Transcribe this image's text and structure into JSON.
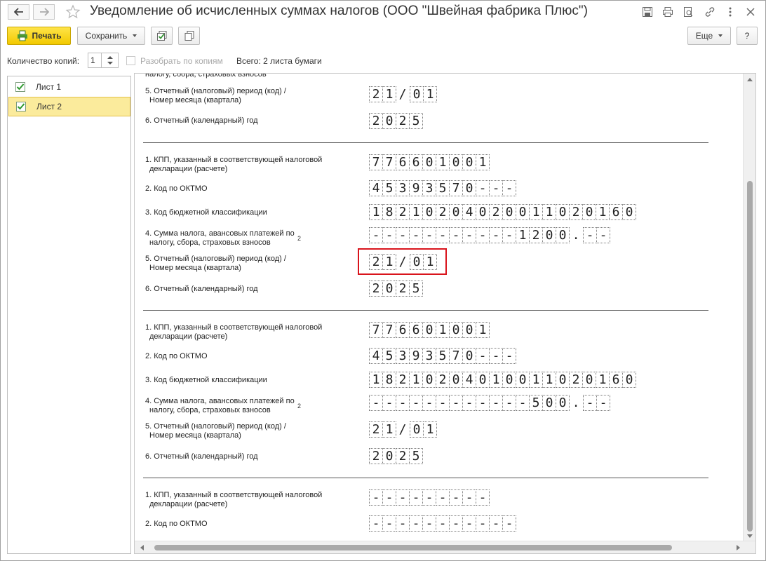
{
  "window": {
    "title": "Уведомление об исчисленных суммах налогов (ООО \"Швейная фабрика Плюс\")"
  },
  "toolbar": {
    "print_label": "Печать",
    "save_label": "Сохранить",
    "more_label": "Еще",
    "help_label": "?"
  },
  "copies": {
    "label": "Количество копий:",
    "value": "1",
    "collate_label": "Разобрать по копиям",
    "total_label": "Всего: 2 листа бумаги"
  },
  "sheets": [
    {
      "label": "Лист 1",
      "checked": true,
      "active": false
    },
    {
      "label": "Лист 2",
      "checked": true,
      "active": true
    }
  ],
  "document": {
    "top_cut_label": "налогу, сбора, страховых взносов",
    "block0": {
      "period_label_1": "5. Отчетный (налоговый) период (код) /",
      "period_label_2": "Номер месяца (квартала)",
      "period_a": [
        "2",
        "1"
      ],
      "period_b": [
        "0",
        "1"
      ],
      "year_label": "6. Отчетный (календарный) год",
      "year": [
        "2",
        "0",
        "2",
        "5"
      ]
    },
    "blocks": [
      {
        "kpp_label_1": "1. КПП, указанный в соответствующей налоговой",
        "kpp_label_2": "декларации (расчете)",
        "kpp": [
          "7",
          "7",
          "6",
          "6",
          "0",
          "1",
          "0",
          "0",
          "1"
        ],
        "oktmo_label": "2. Код по ОКТМО",
        "oktmo": [
          "4",
          "5",
          "3",
          "9",
          "3",
          "5",
          "7",
          "0",
          "-",
          "-",
          "-"
        ],
        "kbk_label": "3. Код бюджетной классификации",
        "kbk": [
          "1",
          "8",
          "2",
          "1",
          "0",
          "2",
          "0",
          "4",
          "0",
          "2",
          "0",
          "0",
          "1",
          "1",
          "0",
          "2",
          "0",
          "1",
          "6",
          "0"
        ],
        "sum_label_1": "4. Сумма налога, авансовых платежей по",
        "sum_label_2": "налогу, сбора, страховых взносов",
        "sum_note": "2",
        "sum_int": [
          "-",
          "-",
          "-",
          "-",
          "-",
          "-",
          "-",
          "-",
          "-",
          "-",
          "-",
          "1",
          "2",
          "0",
          "0"
        ],
        "sum_frac": [
          "-",
          "-"
        ],
        "period_label_1": "5. Отчетный (налоговый) период (код) /",
        "period_label_2": "Номер месяца (квартала)",
        "period_a": [
          "2",
          "1"
        ],
        "period_b": [
          "0",
          "1"
        ],
        "year_label": "6. Отчетный (календарный) год",
        "year": [
          "2",
          "0",
          "2",
          "5"
        ]
      },
      {
        "kpp_label_1": "1. КПП, указанный в соответствующей налоговой",
        "kpp_label_2": "декларации (расчете)",
        "kpp": [
          "7",
          "7",
          "6",
          "6",
          "0",
          "1",
          "0",
          "0",
          "1"
        ],
        "oktmo_label": "2. Код по ОКТМО",
        "oktmo": [
          "4",
          "5",
          "3",
          "9",
          "3",
          "5",
          "7",
          "0",
          "-",
          "-",
          "-"
        ],
        "kbk_label": "3. Код бюджетной классификации",
        "kbk": [
          "1",
          "8",
          "2",
          "1",
          "0",
          "2",
          "0",
          "4",
          "0",
          "1",
          "0",
          "0",
          "1",
          "1",
          "0",
          "2",
          "0",
          "1",
          "6",
          "0"
        ],
        "sum_label_1": "4. Сумма налога, авансовых платежей по",
        "sum_label_2": "налогу, сбора, страховых взносов",
        "sum_note": "2",
        "sum_int": [
          "-",
          "-",
          "-",
          "-",
          "-",
          "-",
          "-",
          "-",
          "-",
          "-",
          "-",
          "-",
          "5",
          "0",
          "0"
        ],
        "sum_frac": [
          "-",
          "-"
        ],
        "period_label_1": "5. Отчетный (налоговый) период (код) /",
        "period_label_2": "Номер месяца (квартала)",
        "period_a": [
          "2",
          "1"
        ],
        "period_b": [
          "0",
          "1"
        ],
        "year_label": "6. Отчетный (календарный) год",
        "year": [
          "2",
          "0",
          "2",
          "5"
        ]
      }
    ],
    "block_last": {
      "kpp_label_1": "1. КПП, указанный в соответствующей налоговой",
      "kpp_label_2": "декларации (расчете)",
      "kpp": [
        "-",
        "-",
        "-",
        "-",
        "-",
        "-",
        "-",
        "-",
        "-"
      ],
      "oktmo_label": "2. Код по ОКТМО",
      "oktmo": [
        "-",
        "-",
        "-",
        "-",
        "-",
        "-",
        "-",
        "-",
        "-",
        "-",
        "-"
      ]
    }
  },
  "colors": {
    "print_button": "#f2c900",
    "active_sheet": "#fbeb9c",
    "highlight": "#d9141c"
  }
}
